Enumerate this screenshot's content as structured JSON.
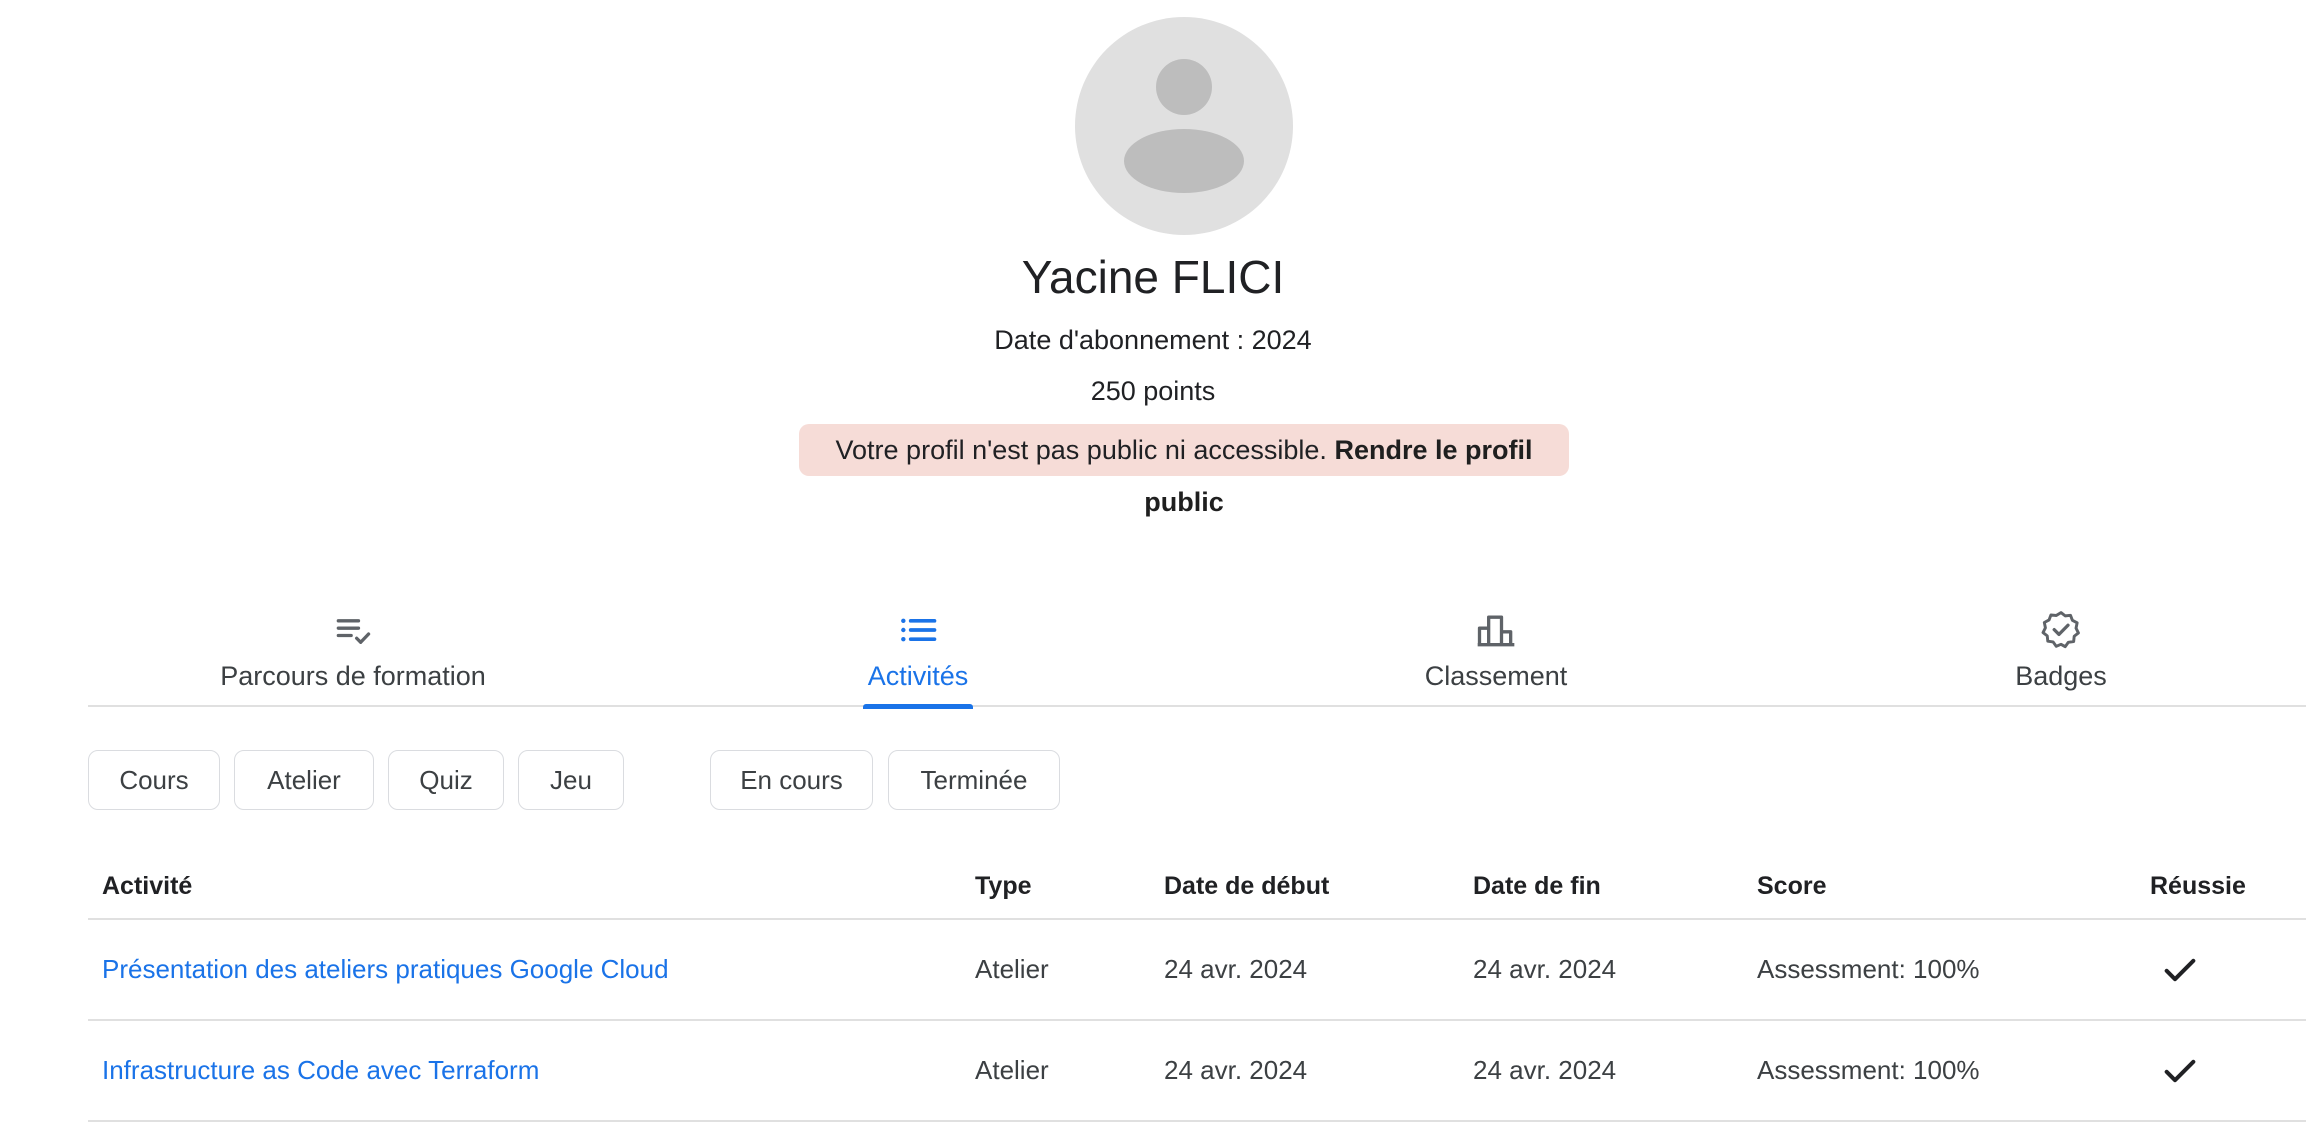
{
  "profile": {
    "name": "Yacine FLICI",
    "subscription": "Date d'abonnement : 2024",
    "points": "250 points",
    "notice_text": "Votre profil n'est pas public ni accessible.",
    "notice_link": "Rendre le profil public",
    "notice_bg": "#f6dcd7"
  },
  "tabs": [
    {
      "label": "Parcours de formation",
      "icon": "playlist-check-icon",
      "active": false
    },
    {
      "label": "Activités",
      "icon": "list-icon",
      "active": true
    },
    {
      "label": "Classement",
      "icon": "leaderboard-icon",
      "active": false
    },
    {
      "label": "Badges",
      "icon": "verified-badge-icon",
      "active": false
    }
  ],
  "filters": {
    "type": [
      "Cours",
      "Atelier",
      "Quiz",
      "Jeu"
    ],
    "status": [
      "En cours",
      "Terminée"
    ]
  },
  "table": {
    "headers": {
      "activity": "Activité",
      "type": "Type",
      "start": "Date de début",
      "end": "Date de fin",
      "score": "Score",
      "passed": "Réussie"
    },
    "rows": [
      {
        "activity": "Présentation des ateliers pratiques Google Cloud",
        "type": "Atelier",
        "start": "24 avr. 2024",
        "end": "24 avr. 2024",
        "score": "Assessment: 100%",
        "passed_icon": "check-icon"
      },
      {
        "activity": "Infrastructure as Code avec Terraform",
        "type": "Atelier",
        "start": "24 avr. 2024",
        "end": "24 avr. 2024",
        "score": "Assessment: 100%",
        "passed_icon": "check-icon"
      }
    ]
  },
  "colors": {
    "accent": "#1a73e8",
    "text": "#3c4043",
    "divider": "#e0e0e0"
  }
}
